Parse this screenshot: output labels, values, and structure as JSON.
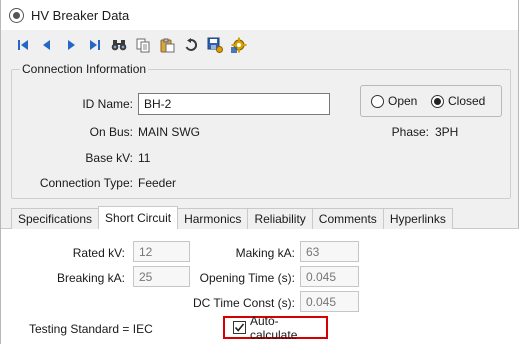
{
  "window": {
    "title": "HV Breaker Data"
  },
  "toolbar": {
    "buttons": [
      "first-record",
      "previous-record",
      "next-record",
      "last-record",
      "find",
      "copy",
      "paste",
      "undo",
      "save",
      "settings"
    ]
  },
  "connection": {
    "group_title": "Connection Information",
    "id_label": "ID Name:",
    "id_value": "BH-2",
    "bus_label": "On Bus:",
    "bus_value": "MAIN SWG",
    "basekv_label": "Base kV:",
    "basekv_value": "11",
    "conn_type_label": "Connection Type:",
    "conn_type_value": "Feeder",
    "phase_label": "Phase:",
    "phase_value": "3PH",
    "state_options": [
      {
        "label": "Open",
        "selected": false
      },
      {
        "label": "Closed",
        "selected": true
      }
    ]
  },
  "tabs": [
    "Specifications",
    "Short Circuit",
    "Harmonics",
    "Reliability",
    "Comments",
    "Hyperlinks"
  ],
  "active_tab": "Short Circuit",
  "short_circuit": {
    "rated_kv_label": "Rated kV:",
    "rated_kv_value": "12",
    "breaking_ka_label": "Breaking kA:",
    "breaking_ka_value": "25",
    "making_ka_label": "Making kA:",
    "making_ka_value": "63",
    "opening_time_label": "Opening Time (s):",
    "opening_time_value": "0.045",
    "dc_time_label": "DC Time Const (s):",
    "dc_time_value": "0.045",
    "testing_standard_text": "Testing Standard  =  IEC",
    "auto_calc_label": "Auto-calculate",
    "auto_calc_checked": true
  },
  "colors": {
    "highlight_border": "#d60000",
    "nav_blue": "#2467c9"
  }
}
